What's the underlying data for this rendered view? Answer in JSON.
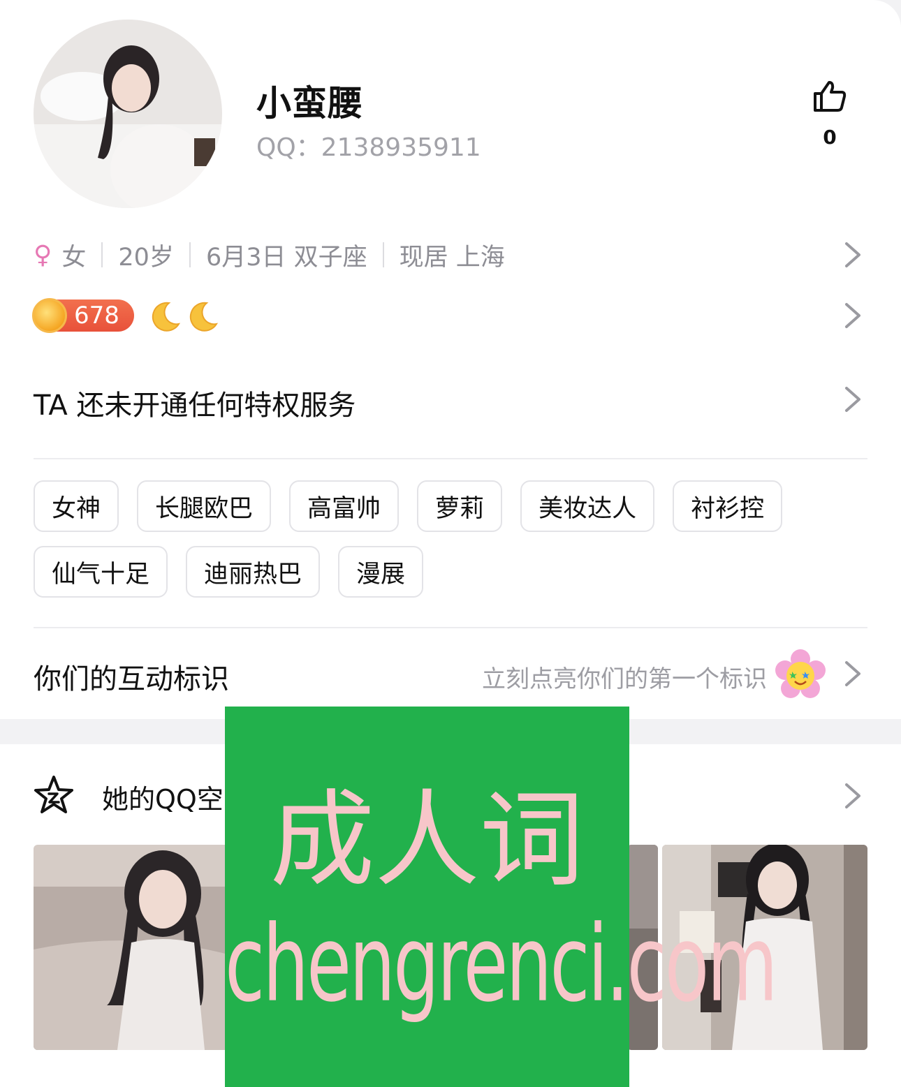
{
  "profile": {
    "name": "小蛮腰",
    "qq": "QQ：2138935911",
    "like_count": "0"
  },
  "info": {
    "gender_symbol": "♀",
    "gender": "女",
    "age": "20岁",
    "birthday": "6月3日 双子座",
    "residence": "现居 上海"
  },
  "level": {
    "value": "678"
  },
  "privilege": {
    "text": "TA 还未开通任何特权服务"
  },
  "tags": [
    "女神",
    "长腿欧巴",
    "高富帅",
    "萝莉",
    "美妆达人",
    "衬衫控",
    "仙气十足",
    "迪丽热巴",
    "漫展"
  ],
  "interaction": {
    "title": "你们的互动标识",
    "hint": "立刻点亮你们的第一个标识"
  },
  "space": {
    "title": "她的QQ空"
  },
  "watermark": {
    "line1": "成人词",
    "line2": "chengrenci.com"
  },
  "colors": {
    "watermark_bg": "#22b14c",
    "watermark_text": "#f7c6c9",
    "badge": "#e8513a",
    "gender": "#e678b4"
  }
}
